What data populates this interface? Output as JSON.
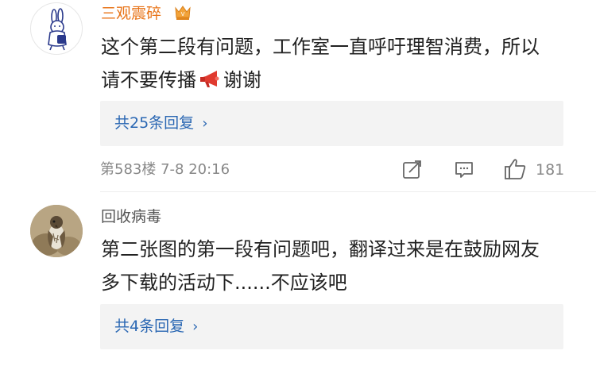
{
  "comments": [
    {
      "username": "三观震碎",
      "text_line1": "这个第二段有问题，工作室一直呼吁理智消费，所以",
      "text_line2": "请不要传播",
      "text_tail": "谢谢",
      "reply_label": "共25条回复",
      "floor": "第583楼",
      "datetime": "7-8 20:16",
      "likes": "181"
    },
    {
      "username": "回收病毒",
      "text_line1": "第二张图的第一段有问题吧，翻译过来是在鼓励网友",
      "text_line2": "多下载的活动下......不应该吧",
      "reply_label": "共4条回复"
    }
  ],
  "icons": {
    "vip_badge": "crown-badge-icon",
    "megaphone": "megaphone-icon",
    "reply_chevron": "chevron-right-icon",
    "share": "share-icon",
    "comment": "comment-icon",
    "like": "thumbs-up-icon"
  },
  "colors": {
    "vip_username": "#e8751a",
    "link_blue": "#2a67b3",
    "meta_gray": "#888888",
    "reply_bg": "#f3f3f3"
  }
}
